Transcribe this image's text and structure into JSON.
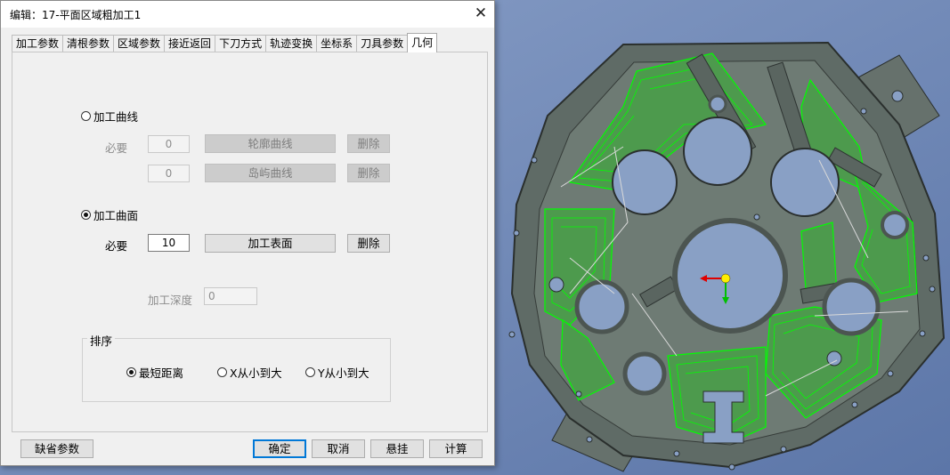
{
  "dialog": {
    "title": "编辑：17-平面区域粗加工1",
    "close_glyph": "✕"
  },
  "tabs": [
    {
      "label": "加工参数",
      "active": false
    },
    {
      "label": "清根参数",
      "active": false
    },
    {
      "label": "区域参数",
      "active": false
    },
    {
      "label": "接近返回",
      "active": false
    },
    {
      "label": "下刀方式",
      "active": false
    },
    {
      "label": "轨迹变换",
      "active": false
    },
    {
      "label": "坐标系",
      "active": false
    },
    {
      "label": "刀具参数",
      "active": false
    },
    {
      "label": "几何",
      "active": true
    }
  ],
  "curve": {
    "radio_label": "加工曲线",
    "selected": false,
    "required_label": "必要",
    "contour_count": "0",
    "contour_button": "轮廓曲线",
    "contour_delete": "删除",
    "island_count": "0",
    "island_button": "岛屿曲线",
    "island_delete": "删除"
  },
  "surface": {
    "radio_label": "加工曲面",
    "selected": true,
    "required_label": "必要",
    "count": "10",
    "button": "加工表面",
    "delete": "删除"
  },
  "depth": {
    "label": "加工深度",
    "value": "0"
  },
  "sort": {
    "group_label": "排序",
    "options": [
      {
        "label": "最短距离",
        "selected": true
      },
      {
        "label": "X从小到大",
        "selected": false
      },
      {
        "label": "Y从小到大",
        "selected": false
      }
    ]
  },
  "footer": {
    "defaults": "缺省参数",
    "ok": "确定",
    "cancel": "取消",
    "suspend": "悬挂",
    "compute": "计算"
  },
  "colors": {
    "viewport_background": "#6b86b8",
    "part_body": "#5f6b66",
    "toolpath": "#00ff00",
    "tabs_accent": "#0078d7"
  }
}
